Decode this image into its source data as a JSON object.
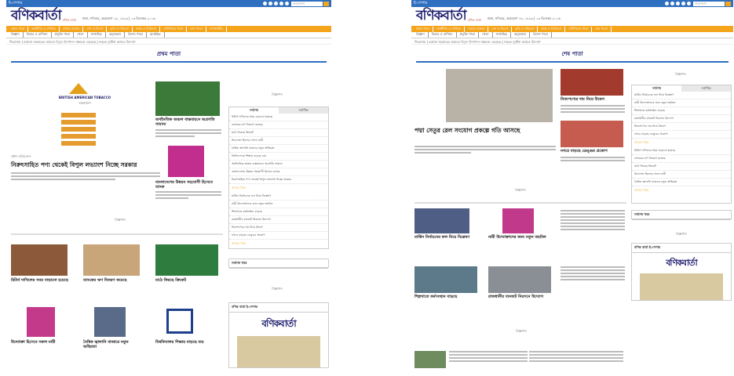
{
  "left": {
    "topbar": {
      "label": "ই-পেপার",
      "search_placeholder": "অনুসন্ধান"
    },
    "masthead": {
      "logo": "বণিকবার্তা",
      "tagline": "বণিক বার্তা",
      "date": "ঢাকা, শনিবার, অগ্রহায়ণ ১৮, ১৪২৩ | ০৩ ডিসেম্বর ২০১৬"
    },
    "nav": [
      "প্রথম পাতা",
      "অর্থনীতি ও বাণিজ্য",
      "শেয়ার বাজার",
      "দেশ ও বিদেশ",
      "কৃষি ও পরিবেশ",
      "স্বাস্থ্য ও চিকিৎসা",
      "বাণিজ্যিক পাতা",
      "শেষ পাতা",
      "সম্পাদকীয়",
      "খেলা",
      "আন্তর্জাতিক"
    ],
    "subnav": [
      "বিজ্ঞান",
      "ফিচার ও বাণিজ্য",
      "প্রযুক্তি পাতা",
      "খেলা",
      "সাপ্তাহিক",
      "অনুসন্ধান",
      "বিশেষ পাতা",
      "আর্কাইভ"
    ],
    "ticker": "শিরোনাম  |  বর্তমান সরকারের আমলে বিদ্যুৎ উৎপাদন সক্ষমতা বেড়েছে  |  সড়কে দুর্ঘটনা কমাতে উদ্যোগ",
    "section_title": "প্রথম পাতা",
    "ad_label": "বিজ্ঞাপন",
    "brand": {
      "name": "BRITISH AMERICAN TOBACCO",
      "line": "বাংলাদেশ"
    },
    "lead": {
      "kicker": "প্রধান প্রতিবেদন",
      "headline": "নিরুৎসাহিত পণ্য থেকেই বিপুল লভ্যাংশ নিচ্ছে সরকার"
    },
    "story1": "অর্থনৈতিক অঞ্চল বাস্তবায়নে অগ্রগতি সামান্য",
    "story2": "বাংলাদেশের উন্নয়ন সহযোগী হিসেবে ব্যাংক",
    "tabs": [
      "সর্বশেষ",
      "সর্বাধিক"
    ],
    "more": "আরও খবর",
    "latest_box": "সর্বশেষ খবর",
    "epaper_box": "বণিক বার্তা ই-পেপার",
    "grid": [
      "রিটার্ন দাখিলের সময় বাড়ানো হয়েছে",
      "ব্যাংকের ঋণ বিতরণ কমেছে",
      "মাঠে ফিরছে ক্রিকেট",
      "উদ্যোক্তা হিসেবে সফল নারী",
      "বৈশ্বিক জ্বালানি বাজারে নতুন অস্থিরতা",
      "বিশ্ববিদ্যালয় শিক্ষায় বাড়ছে ব্যয়"
    ]
  },
  "right": {
    "section_title": "শেষ পাতা",
    "headline": "পদ্মা সেতুর রেল সংযোগ প্রকল্পে গতি আসছে",
    "story1": "নিত্যপণ্যের দাম নিয়ে উদ্বেগ",
    "story2": "নগরে বাড়ছে ডেঙ্গুর প্রকোপ",
    "grid": [
      "মার্কিন নির্বাচনের ফল নিয়ে বিশ্লেষণ",
      "নারী উদ্যোক্তাদের জন্য নতুন তহবিল",
      "শিল্পখাতে কর্মসংস্থান বাড়ছে",
      "রাজধানীর যানজট নিরসনে উদ্যোগ"
    ],
    "ad_label": "বিজ্ঞাপন",
    "latest_box": "সর্বশেষ খবর",
    "epaper_box": "বণিক বার্তা ই-পেপার"
  },
  "colors": {
    "accent": "#f4a51c",
    "bar": "#2f6fc0",
    "logo": "#1d1d6e"
  }
}
